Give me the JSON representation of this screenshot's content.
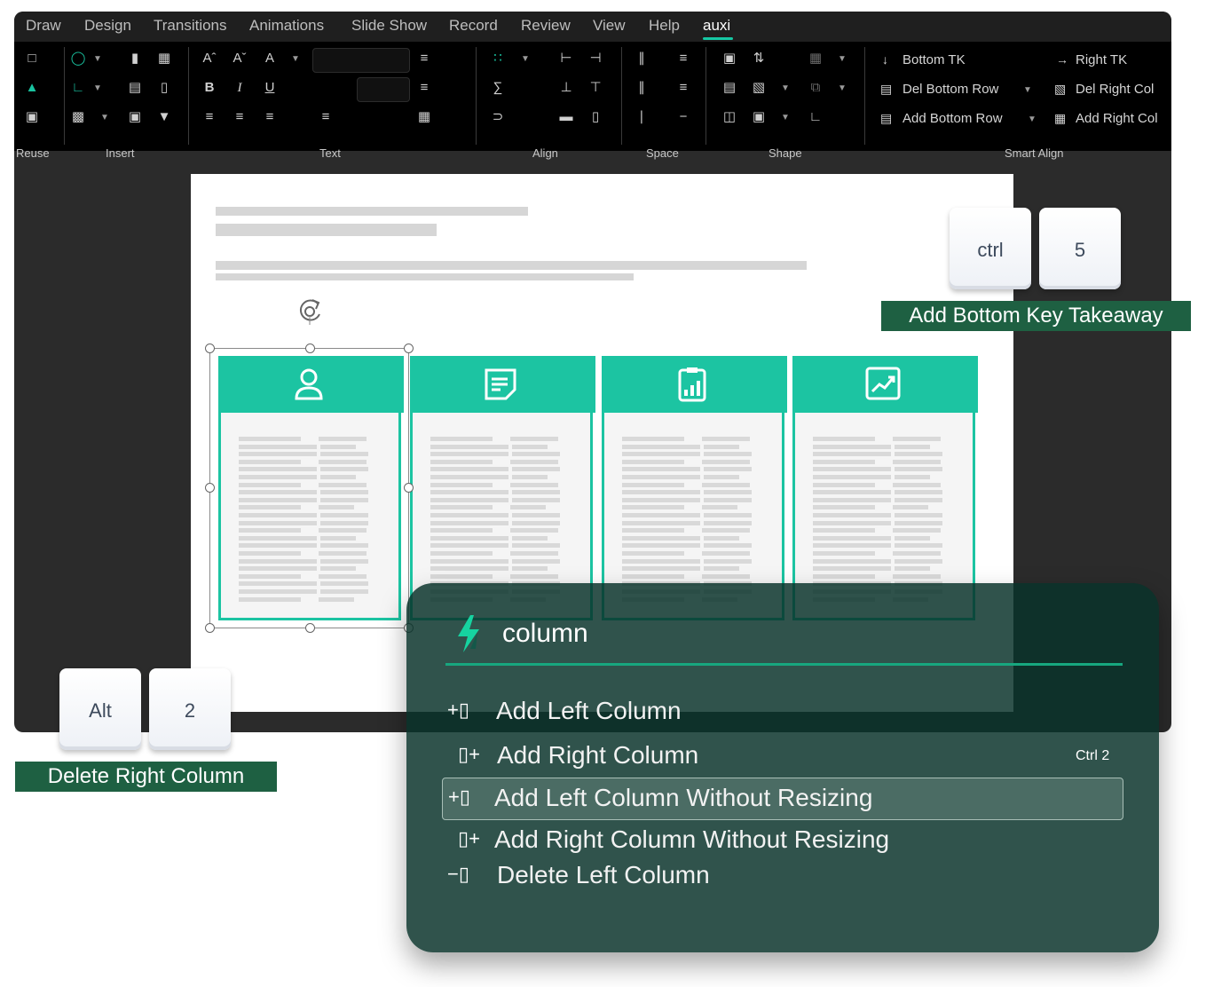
{
  "menu": {
    "tabs": [
      "Draw",
      "Design",
      "Transitions",
      "Animations",
      "Slide Show",
      "Record",
      "Review",
      "View",
      "Help",
      "auxi"
    ],
    "active": "auxi"
  },
  "ribbon": {
    "groups": {
      "reuse": "Reuse",
      "insert": "Insert",
      "text": "Text",
      "align": "Align",
      "space": "Space",
      "shape": "Shape",
      "smart_align": "Smart Align"
    },
    "text_format": {
      "bold": "B",
      "italic": "I",
      "underline": "U"
    },
    "smart_align_items": {
      "bottom_tk": "Bottom TK",
      "right_tk": "Right TK",
      "del_bottom_row": "Del Bottom Row",
      "del_right_col": "Del Right Col",
      "add_bottom_row": "Add Bottom Row",
      "add_right_col": "Add Right Col"
    }
  },
  "keys": {
    "top": {
      "k1": "ctrl",
      "k2": "5",
      "label": "Add Bottom Key Takeaway"
    },
    "bottom": {
      "k1": "Alt",
      "k2": "2",
      "label": "Delete Right Column"
    }
  },
  "popup": {
    "query": "column",
    "items": [
      {
        "label": "Add Left Column",
        "shortcut": ""
      },
      {
        "label": "Add Right Column",
        "shortcut": "Ctrl 2"
      },
      {
        "label": "Add Left Column Without Resizing",
        "shortcut": ""
      },
      {
        "label": "Add Right Column Without Resizing",
        "shortcut": ""
      },
      {
        "label": "Delete Left Column",
        "shortcut": ""
      }
    ],
    "selected_index": 2
  },
  "colors": {
    "accent": "#1cc4a2",
    "tag_bg": "#1e6042",
    "popup_bg": "#08322a"
  },
  "icons": [
    "person-icon",
    "document-icon",
    "clipboard-chart-icon",
    "trend-chart-icon",
    "lightning-icon",
    "rotate-handle-icon"
  ]
}
